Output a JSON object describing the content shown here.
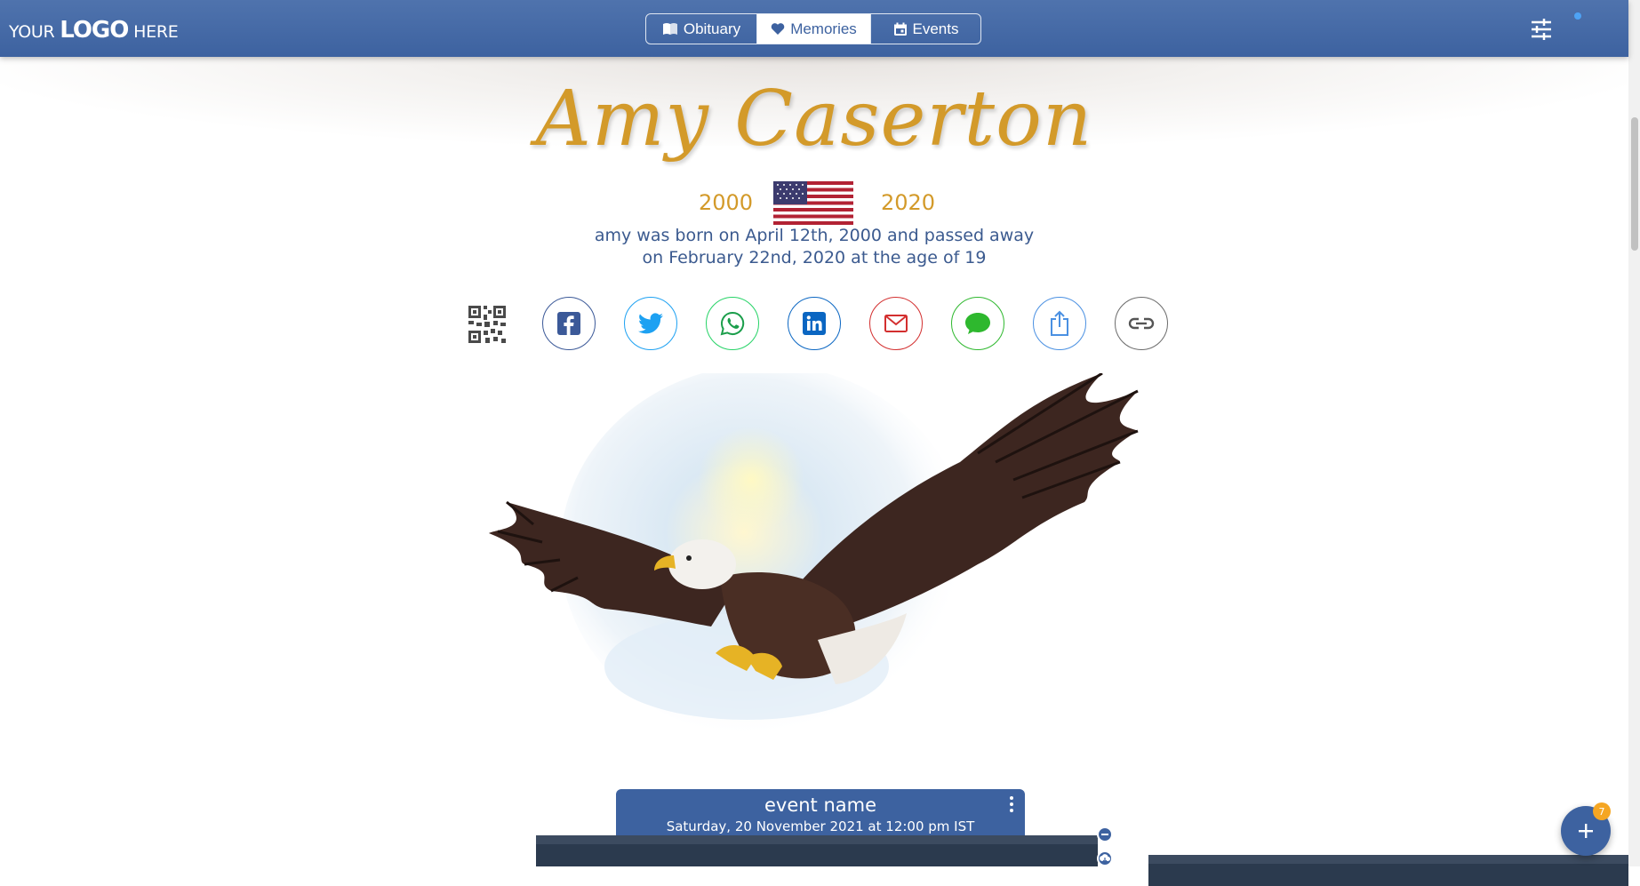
{
  "header": {
    "logo": {
      "prefix": "YOUR",
      "brand": "LOGO",
      "suffix": "HERE"
    },
    "tabs": [
      {
        "label": "Obituary",
        "icon": "book-open-icon",
        "active": false
      },
      {
        "label": "Memories",
        "icon": "heart-icon",
        "active": true
      },
      {
        "label": "Events",
        "icon": "calendar-icon",
        "active": false
      }
    ],
    "filter_icon": "sliders-icon",
    "avatar_icon": "user-avatar"
  },
  "hero": {
    "name": "Amy Caserton",
    "birth_year": "2000",
    "death_year": "2020",
    "flag_icon": "us-flag-icon",
    "bio": "amy was born on April 12th, 2000 and passed away on February 22nd, 2020 at the age of 19"
  },
  "share": {
    "items": [
      {
        "name": "qr-code",
        "icon": "qr-code-icon"
      },
      {
        "name": "facebook",
        "icon": "facebook-icon",
        "color": "#3b5998"
      },
      {
        "name": "twitter",
        "icon": "twitter-icon",
        "color": "#1da1f2"
      },
      {
        "name": "whatsapp",
        "icon": "whatsapp-icon",
        "color": "#25d366"
      },
      {
        "name": "linkedin",
        "icon": "linkedin-icon",
        "color": "#0a66c2"
      },
      {
        "name": "email",
        "icon": "mail-icon",
        "color": "#d32f2f"
      },
      {
        "name": "sms",
        "icon": "chat-icon",
        "color": "#2eb82e"
      },
      {
        "name": "share",
        "icon": "share-icon",
        "color": "#4a90e2"
      },
      {
        "name": "copy-link",
        "icon": "link-icon",
        "color": "#555555"
      }
    ]
  },
  "event": {
    "name": "event name",
    "date": "Saturday, 20 November 2021 at 12:00 pm IST",
    "menu_icon": "kebab-menu-icon"
  },
  "fab": {
    "icon": "plus-icon",
    "badge": "7"
  },
  "colors": {
    "primary": "#3d62a0",
    "gold": "#d39a2a",
    "text": "#3b5a8f"
  }
}
